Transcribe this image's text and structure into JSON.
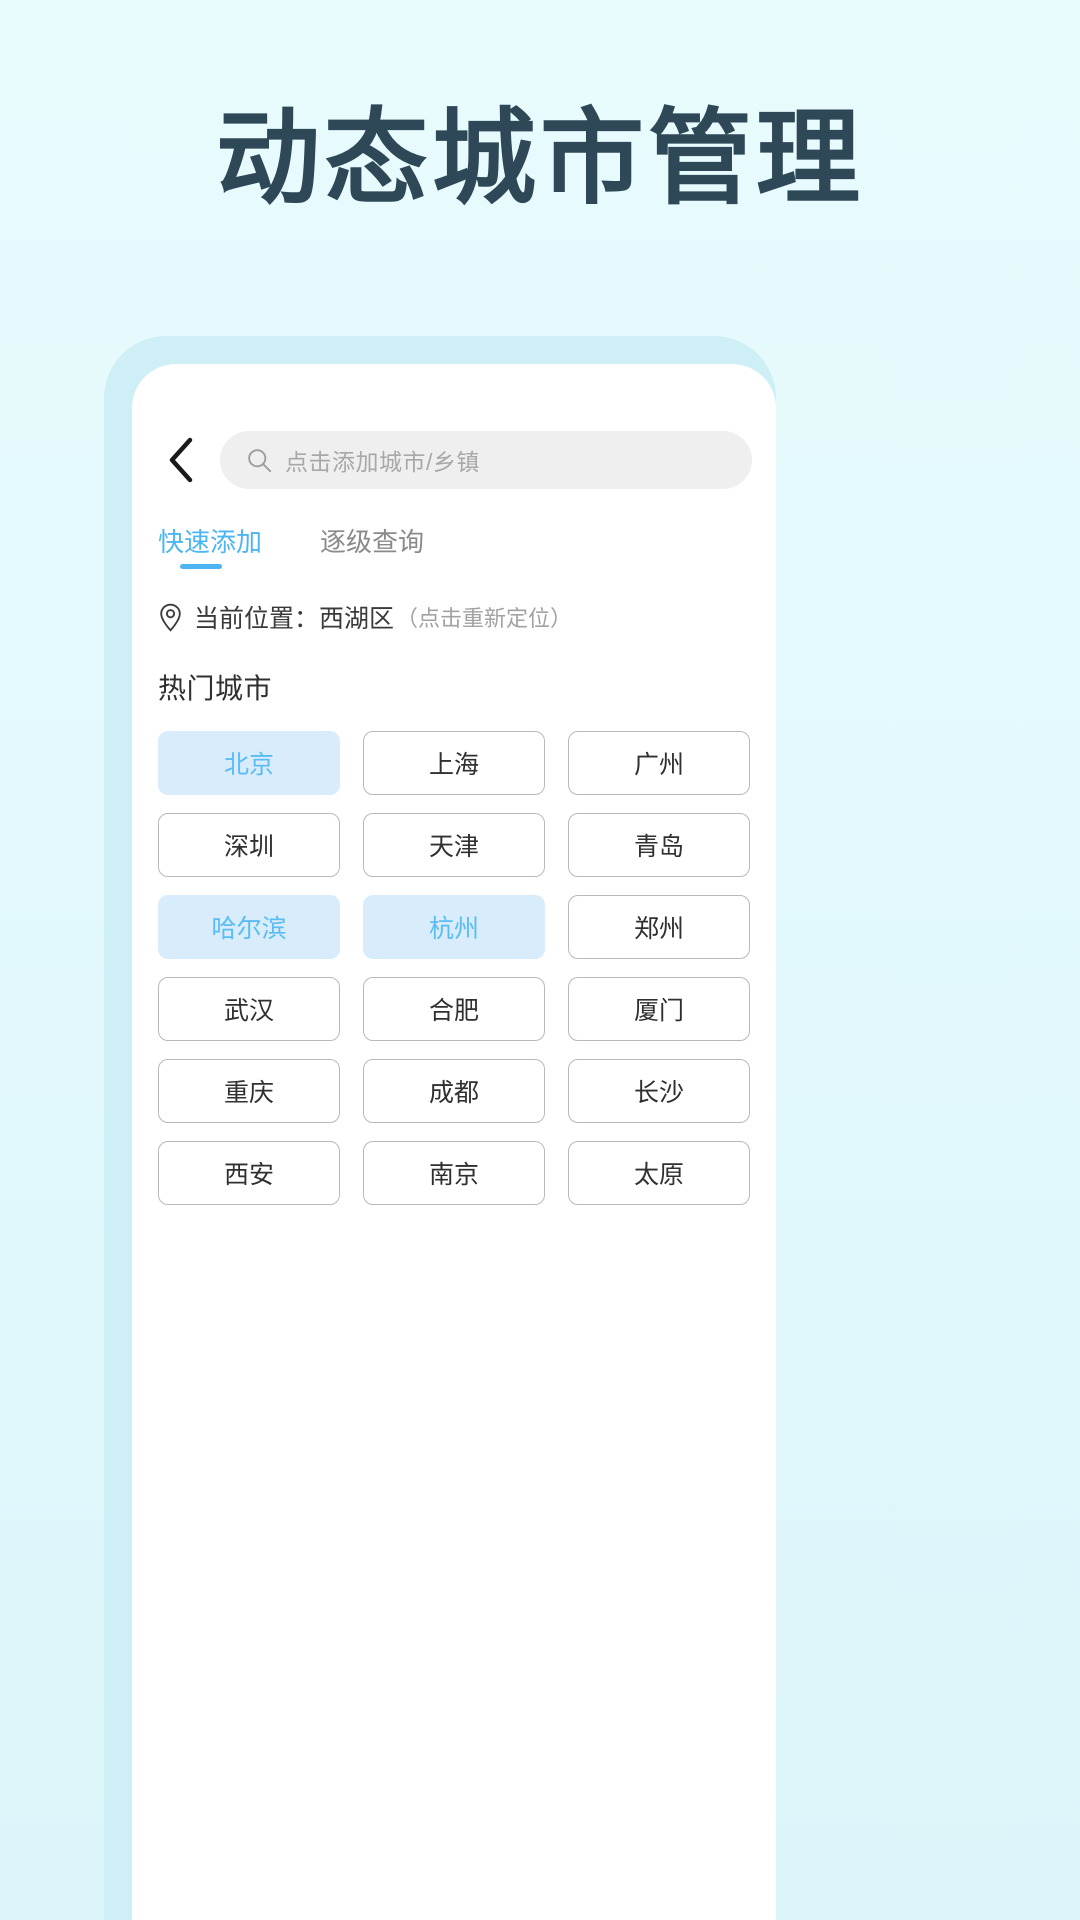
{
  "hero": {
    "title": "动态城市管理",
    "title_color": "#2f4858"
  },
  "theme": {
    "page_bg": "#e4f9fc",
    "accent": "#4db5f2",
    "chip_selected_bg": "#d8ecfb",
    "chip_border": "#b9b9b9",
    "phone_frame": "#ceeff5"
  },
  "screen": {
    "topbar": {
      "back_icon": "chevron-left-icon",
      "search": {
        "icon": "search-icon",
        "value": "",
        "placeholder": "点击添加城市/乡镇"
      }
    },
    "tabs": [
      {
        "label": "快速添加",
        "active": true
      },
      {
        "label": "逐级查询",
        "active": false
      }
    ],
    "location": {
      "icon": "map-pin-icon",
      "label": "当前位置：西湖区",
      "hint": "（点击重新定位）"
    },
    "hot_cities": {
      "section_title": "热门城市",
      "chips": [
        {
          "label": "北京",
          "selected": true
        },
        {
          "label": "上海",
          "selected": false
        },
        {
          "label": "广州",
          "selected": false
        },
        {
          "label": "深圳",
          "selected": false
        },
        {
          "label": "天津",
          "selected": false
        },
        {
          "label": "青岛",
          "selected": false
        },
        {
          "label": "哈尔滨",
          "selected": true
        },
        {
          "label": "杭州",
          "selected": true
        },
        {
          "label": "郑州",
          "selected": false
        },
        {
          "label": "武汉",
          "selected": false
        },
        {
          "label": "合肥",
          "selected": false
        },
        {
          "label": "厦门",
          "selected": false
        },
        {
          "label": "重庆",
          "selected": false
        },
        {
          "label": "成都",
          "selected": false
        },
        {
          "label": "长沙",
          "selected": false
        },
        {
          "label": "西安",
          "selected": false
        },
        {
          "label": "南京",
          "selected": false
        },
        {
          "label": "太原",
          "selected": false
        }
      ]
    }
  }
}
